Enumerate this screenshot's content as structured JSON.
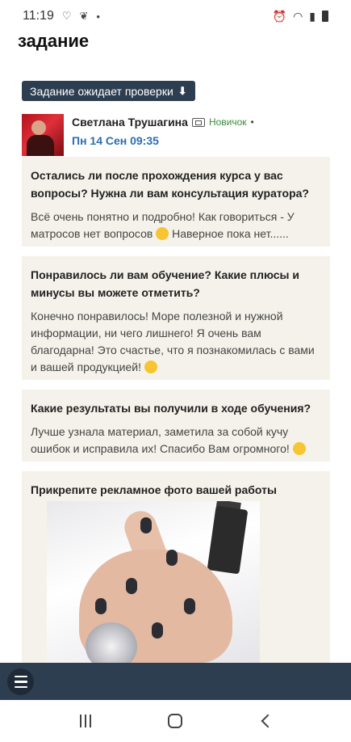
{
  "status_bar": {
    "time": "11:19",
    "dot": "•",
    "left_icons": [
      "heart-outline-icon",
      "leaf-icon"
    ],
    "right_icons": [
      "alarm-icon",
      "wifi-icon",
      "signal-icon",
      "battery-icon"
    ]
  },
  "page": {
    "title": "задание",
    "status_label": "Задание ожидает проверки"
  },
  "author": {
    "name": "Светлана Трушагина",
    "role": "Новичок",
    "separator": "•",
    "date": "Пн 14 Сен 09:35"
  },
  "cards": [
    {
      "question": "Остались ли после прохождения курса у вас вопросы? Нужна ли вам консультация куратора?",
      "answer_before": "Всё очень понятно и подробно! Как говориться - У матросов нет вопросов",
      "answer_after": "Наверное пока нет......"
    },
    {
      "question": "Понравилось ли вам обучение? Какие плюсы и минусы вы можете отметить?",
      "answer_before": "Конечно понравилось! Море полезной и нужной информации, ни чего лишнего! Я очень вам благодарна! Это счастье, что я познакомилась с вами и вашей продукцией!",
      "answer_after": ""
    },
    {
      "question": "Какие результаты вы получили в ходе обучения?",
      "answer_before": "Лучше узнала материал, заметила за собой кучу ошибок и исправила их! Спасибо Вам огромного!",
      "answer_after": ""
    },
    {
      "question": "Прикрепите рекламное фото вашей работы"
    }
  ],
  "colors": {
    "accent": "#2d3e50",
    "card_bg": "#f4f2ea",
    "date": "#2a6db0",
    "role": "#3a8a3a"
  }
}
